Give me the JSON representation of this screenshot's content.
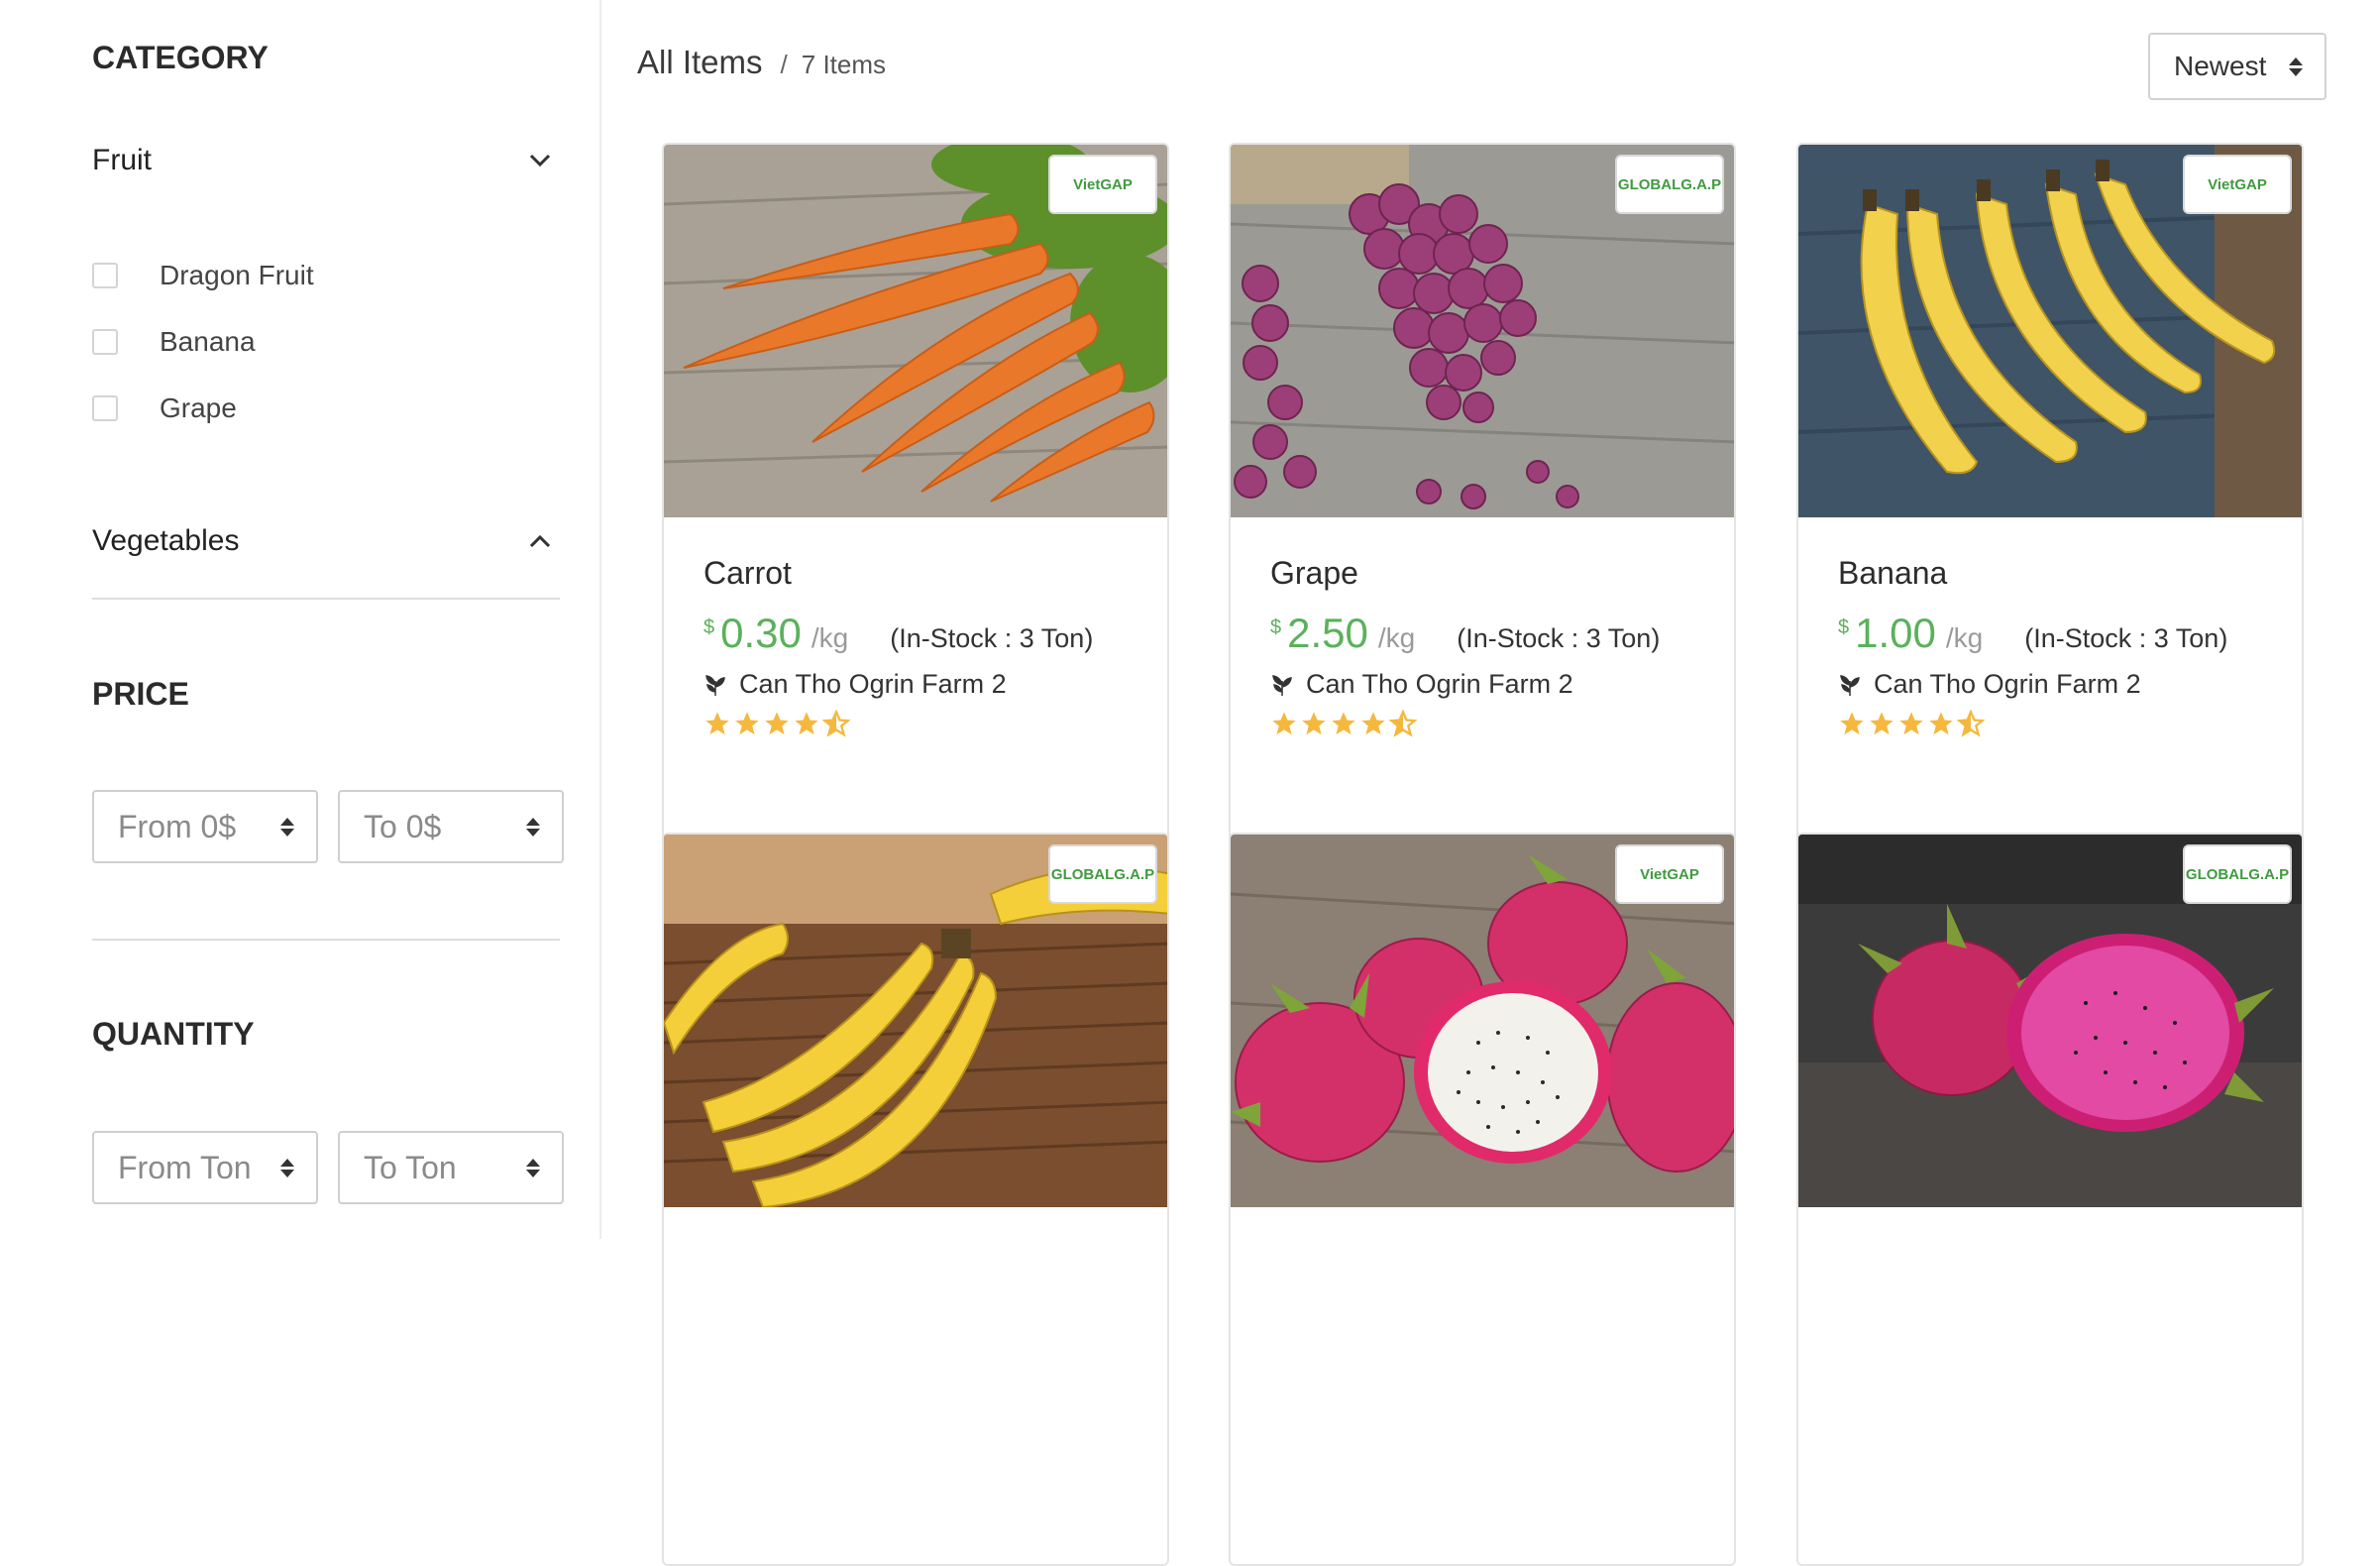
{
  "sidebar": {
    "category_title": "CATEGORY",
    "groups": [
      {
        "label": "Fruit",
        "expanded": true,
        "options": [
          {
            "label": "Dragon Fruit",
            "checked": false
          },
          {
            "label": "Banana",
            "checked": false
          },
          {
            "label": "Grape",
            "checked": false
          }
        ]
      },
      {
        "label": "Vegetables",
        "expanded": false
      }
    ],
    "price": {
      "title": "PRICE",
      "from": "From 0$",
      "to": "To 0$"
    },
    "quantity": {
      "title": "QUANTITY",
      "from": "From Ton",
      "to": "To Ton"
    }
  },
  "header": {
    "title": "All Items",
    "separator": "/",
    "count": "7 Items",
    "sort": "Newest"
  },
  "products": [
    {
      "name": "Carrot",
      "currency": "$",
      "price": "0.30",
      "unit": "/kg",
      "stock": "(In-Stock : 3 Ton)",
      "farm": "Can Tho Ogrin Farm 2",
      "rating": 4.5,
      "badge": "VietGAP"
    },
    {
      "name": "Grape",
      "currency": "$",
      "price": "2.50",
      "unit": "/kg",
      "stock": "(In-Stock : 3 Ton)",
      "farm": "Can Tho Ogrin Farm 2",
      "rating": 4.5,
      "badge": "GLOBALG.A.P"
    },
    {
      "name": "Banana",
      "currency": "$",
      "price": "1.00",
      "unit": "/kg",
      "stock": "(In-Stock : 3 Ton)",
      "farm": "Can Tho Ogrin Farm 2",
      "rating": 4.5,
      "badge": "VietGAP"
    },
    {
      "badge": "GLOBALG.A.P"
    },
    {
      "badge": "VietGAP"
    },
    {
      "badge": "GLOBALG.A.P"
    }
  ],
  "colors": {
    "price_green": "#5bb15b",
    "star": "#f5b83d",
    "border": "#e4e4e4"
  }
}
